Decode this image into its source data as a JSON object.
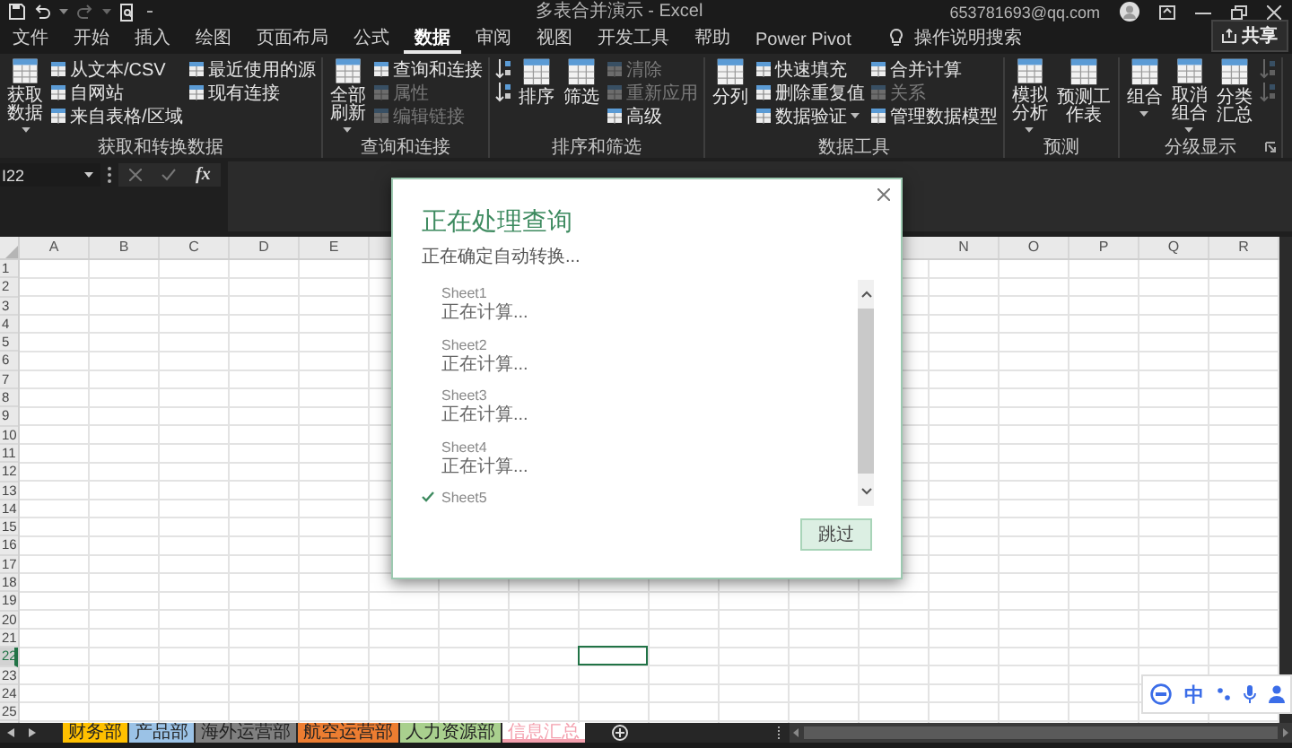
{
  "title_bar": {
    "title": "多表合并演示 - Excel",
    "account": "653781693@qq.com"
  },
  "ribbon_tabs": [
    {
      "label": "文件",
      "selected": false
    },
    {
      "label": "开始",
      "selected": false
    },
    {
      "label": "插入",
      "selected": false
    },
    {
      "label": "绘图",
      "selected": false
    },
    {
      "label": "页面布局",
      "selected": false
    },
    {
      "label": "公式",
      "selected": false
    },
    {
      "label": "数据",
      "selected": true
    },
    {
      "label": "审阅",
      "selected": false
    },
    {
      "label": "视图",
      "selected": false
    },
    {
      "label": "开发工具",
      "selected": false
    },
    {
      "label": "帮助",
      "selected": false
    },
    {
      "label": "Power Pivot",
      "selected": false
    }
  ],
  "tell_me": "操作说明搜索",
  "share_button": "共享",
  "ribbon_groups": [
    {
      "label": "获取和转换数据",
      "launcher": false,
      "columns": [
        {
          "kind": "large",
          "label": "获取数据",
          "disabled": false,
          "dropdown": true
        },
        {
          "kind": "stack",
          "items": [
            {
              "label": "从文本/CSV",
              "disabled": false,
              "dropdown": false
            },
            {
              "label": "自网站",
              "disabled": false,
              "dropdown": false
            },
            {
              "label": "来自表格/区域",
              "disabled": false,
              "dropdown": false
            }
          ]
        },
        {
          "kind": "stack",
          "items": [
            {
              "label": "最近使用的源",
              "disabled": false,
              "dropdown": false
            },
            {
              "label": "现有连接",
              "disabled": false,
              "dropdown": false
            }
          ]
        }
      ]
    },
    {
      "label": "查询和连接",
      "launcher": false,
      "columns": [
        {
          "kind": "large",
          "label": "全部刷新",
          "disabled": false,
          "dropdown": true
        },
        {
          "kind": "stack",
          "items": [
            {
              "label": "查询和连接",
              "disabled": false,
              "dropdown": false
            },
            {
              "label": "属性",
              "disabled": true,
              "dropdown": false
            },
            {
              "label": "编辑链接",
              "disabled": true,
              "dropdown": false
            }
          ]
        }
      ]
    },
    {
      "label": "排序和筛选",
      "launcher": false,
      "columns": [
        {
          "kind": "stack",
          "items": [
            {
              "disabled": false,
              "dropdown": false
            },
            {
              "disabled": false,
              "dropdown": false
            }
          ]
        },
        {
          "kind": "large",
          "label": "排序",
          "disabled": false,
          "dropdown": false
        },
        {
          "kind": "large",
          "label": "筛选",
          "disabled": false,
          "dropdown": false
        },
        {
          "kind": "stack",
          "items": [
            {
              "label": "清除",
              "disabled": true,
              "dropdown": false
            },
            {
              "label": "重新应用",
              "disabled": true,
              "dropdown": false
            },
            {
              "label": "高级",
              "disabled": false,
              "dropdown": false
            }
          ]
        }
      ]
    },
    {
      "label": "数据工具",
      "launcher": false,
      "columns": [
        {
          "kind": "large",
          "label": "分列",
          "disabled": false,
          "dropdown": false
        },
        {
          "kind": "stack",
          "items": [
            {
              "label": "快速填充",
              "disabled": false,
              "dropdown": false
            },
            {
              "label": "删除重复值",
              "disabled": false,
              "dropdown": false
            },
            {
              "label": "数据验证",
              "disabled": false,
              "dropdown": true
            }
          ]
        },
        {
          "kind": "stack",
          "items": [
            {
              "label": "合并计算",
              "disabled": false,
              "dropdown": false
            },
            {
              "label": "关系",
              "disabled": true,
              "dropdown": false
            },
            {
              "label": "管理数据模型",
              "disabled": false,
              "dropdown": false
            }
          ]
        }
      ]
    },
    {
      "label": "预测",
      "launcher": false,
      "columns": [
        {
          "kind": "large",
          "label": "模拟分析",
          "disabled": false,
          "dropdown": true
        },
        {
          "kind": "large",
          "label": "预测工作表",
          "disabled": false,
          "dropdown": false
        }
      ]
    },
    {
      "label": "分级显示",
      "launcher": true,
      "columns": [
        {
          "kind": "large",
          "label": "组合",
          "disabled": false,
          "dropdown": true
        },
        {
          "kind": "large",
          "label": "取消组合",
          "disabled": false,
          "dropdown": true
        },
        {
          "kind": "large",
          "label": "分类汇总",
          "disabled": false,
          "dropdown": false
        },
        {
          "kind": "stack",
          "items": [
            {
              "disabled": true,
              "dropdown": false
            },
            {
              "disabled": true,
              "dropdown": false
            }
          ]
        }
      ]
    }
  ],
  "formula_bar": {
    "name_box": "I22",
    "function_label": "fx"
  },
  "grid": {
    "columns_left": [
      "A",
      "B",
      "C",
      "D",
      "E"
    ],
    "columns_right": [
      "N",
      "O",
      "P",
      "Q",
      "R"
    ],
    "rows": [
      {
        "label": "1",
        "selected": false
      },
      {
        "label": "2",
        "selected": false
      },
      {
        "label": "3",
        "selected": false
      },
      {
        "label": "4",
        "selected": false
      },
      {
        "label": "5",
        "selected": false
      },
      {
        "label": "6",
        "selected": false
      },
      {
        "label": "7",
        "selected": false
      },
      {
        "label": "8",
        "selected": false
      },
      {
        "label": "9",
        "selected": false
      },
      {
        "label": "10",
        "selected": false
      },
      {
        "label": "11",
        "selected": false
      },
      {
        "label": "12",
        "selected": false
      },
      {
        "label": "13",
        "selected": false
      },
      {
        "label": "14",
        "selected": false
      },
      {
        "label": "15",
        "selected": false
      },
      {
        "label": "16",
        "selected": false
      },
      {
        "label": "17",
        "selected": false
      },
      {
        "label": "18",
        "selected": false
      },
      {
        "label": "19",
        "selected": false
      },
      {
        "label": "20",
        "selected": false
      },
      {
        "label": "21",
        "selected": false
      },
      {
        "label": "22",
        "selected": true
      },
      {
        "label": "23",
        "selected": false
      },
      {
        "label": "24",
        "selected": false
      },
      {
        "label": "25",
        "selected": false
      }
    ]
  },
  "sheet_tabs": [
    {
      "label": "财务部",
      "color": "#ffc000",
      "selected": false
    },
    {
      "label": "产品部",
      "color": "#9bc2e6",
      "selected": false
    },
    {
      "label": "海外运营部",
      "color": "#808080",
      "selected": false
    },
    {
      "label": "航空运营部",
      "color": "#ed7d31",
      "selected": false
    },
    {
      "label": "人力资源部",
      "color": "#a9d08e",
      "selected": false
    },
    {
      "label": "信息汇总",
      "color": "#f4a0ae",
      "selected": true
    }
  ],
  "dialog": {
    "title": "正在处理查询",
    "subtitle": "正在确定自动转换...",
    "items": [
      {
        "name": "Sheet1",
        "status": "正在计算...",
        "done": false
      },
      {
        "name": "Sheet2",
        "status": "正在计算...",
        "done": false
      },
      {
        "name": "Sheet3",
        "status": "正在计算...",
        "done": false
      },
      {
        "name": "Sheet4",
        "status": "正在计算...",
        "done": false
      },
      {
        "name": "Sheet5",
        "done": true
      }
    ],
    "skip_button": "跳过"
  },
  "ime_toolbar": {
    "language": "中"
  }
}
